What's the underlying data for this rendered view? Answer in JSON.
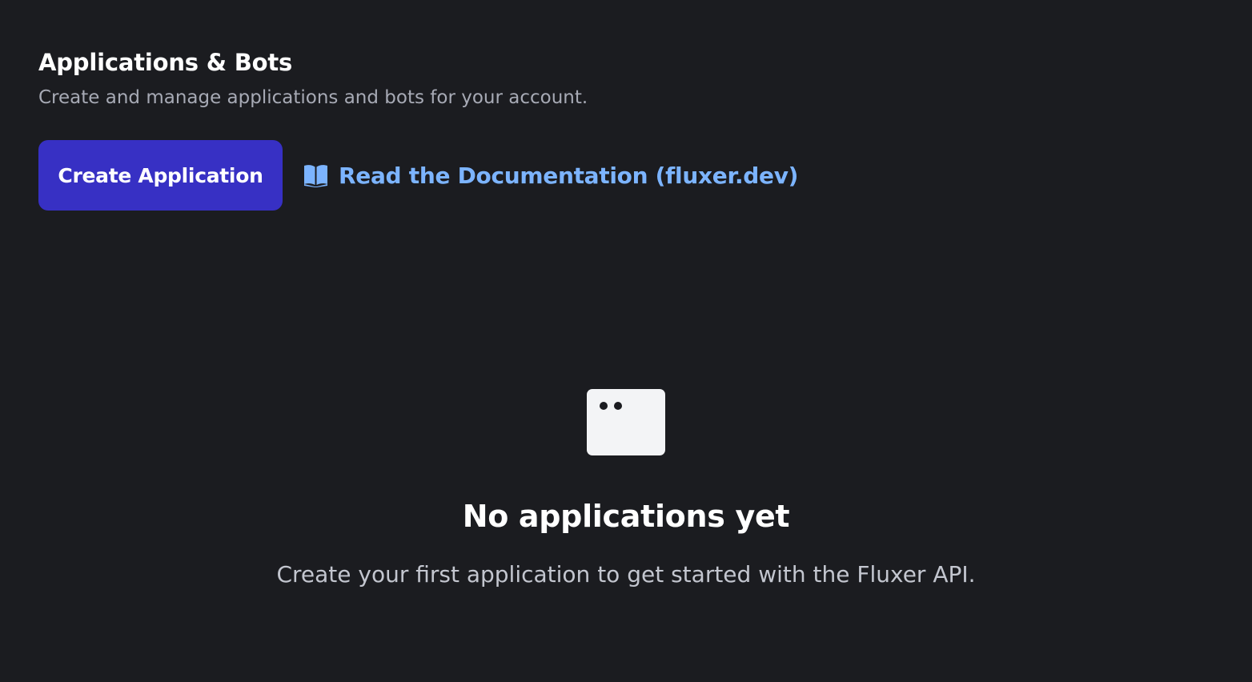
{
  "header": {
    "title": "Applications & Bots",
    "subtitle": "Create and manage applications and bots for your account."
  },
  "actions": {
    "create_label": "Create Application",
    "docs_label": "Read the Documentation (fluxer.dev)",
    "docs_icon": "book-open-icon"
  },
  "empty_state": {
    "icon": "app-window-icon",
    "title": "No applications yet",
    "description": "Create your first application to get started with the Fluxer API."
  },
  "colors": {
    "background": "#1b1c20",
    "primary_button": "#3730c4",
    "link": "#7cb4ff"
  }
}
